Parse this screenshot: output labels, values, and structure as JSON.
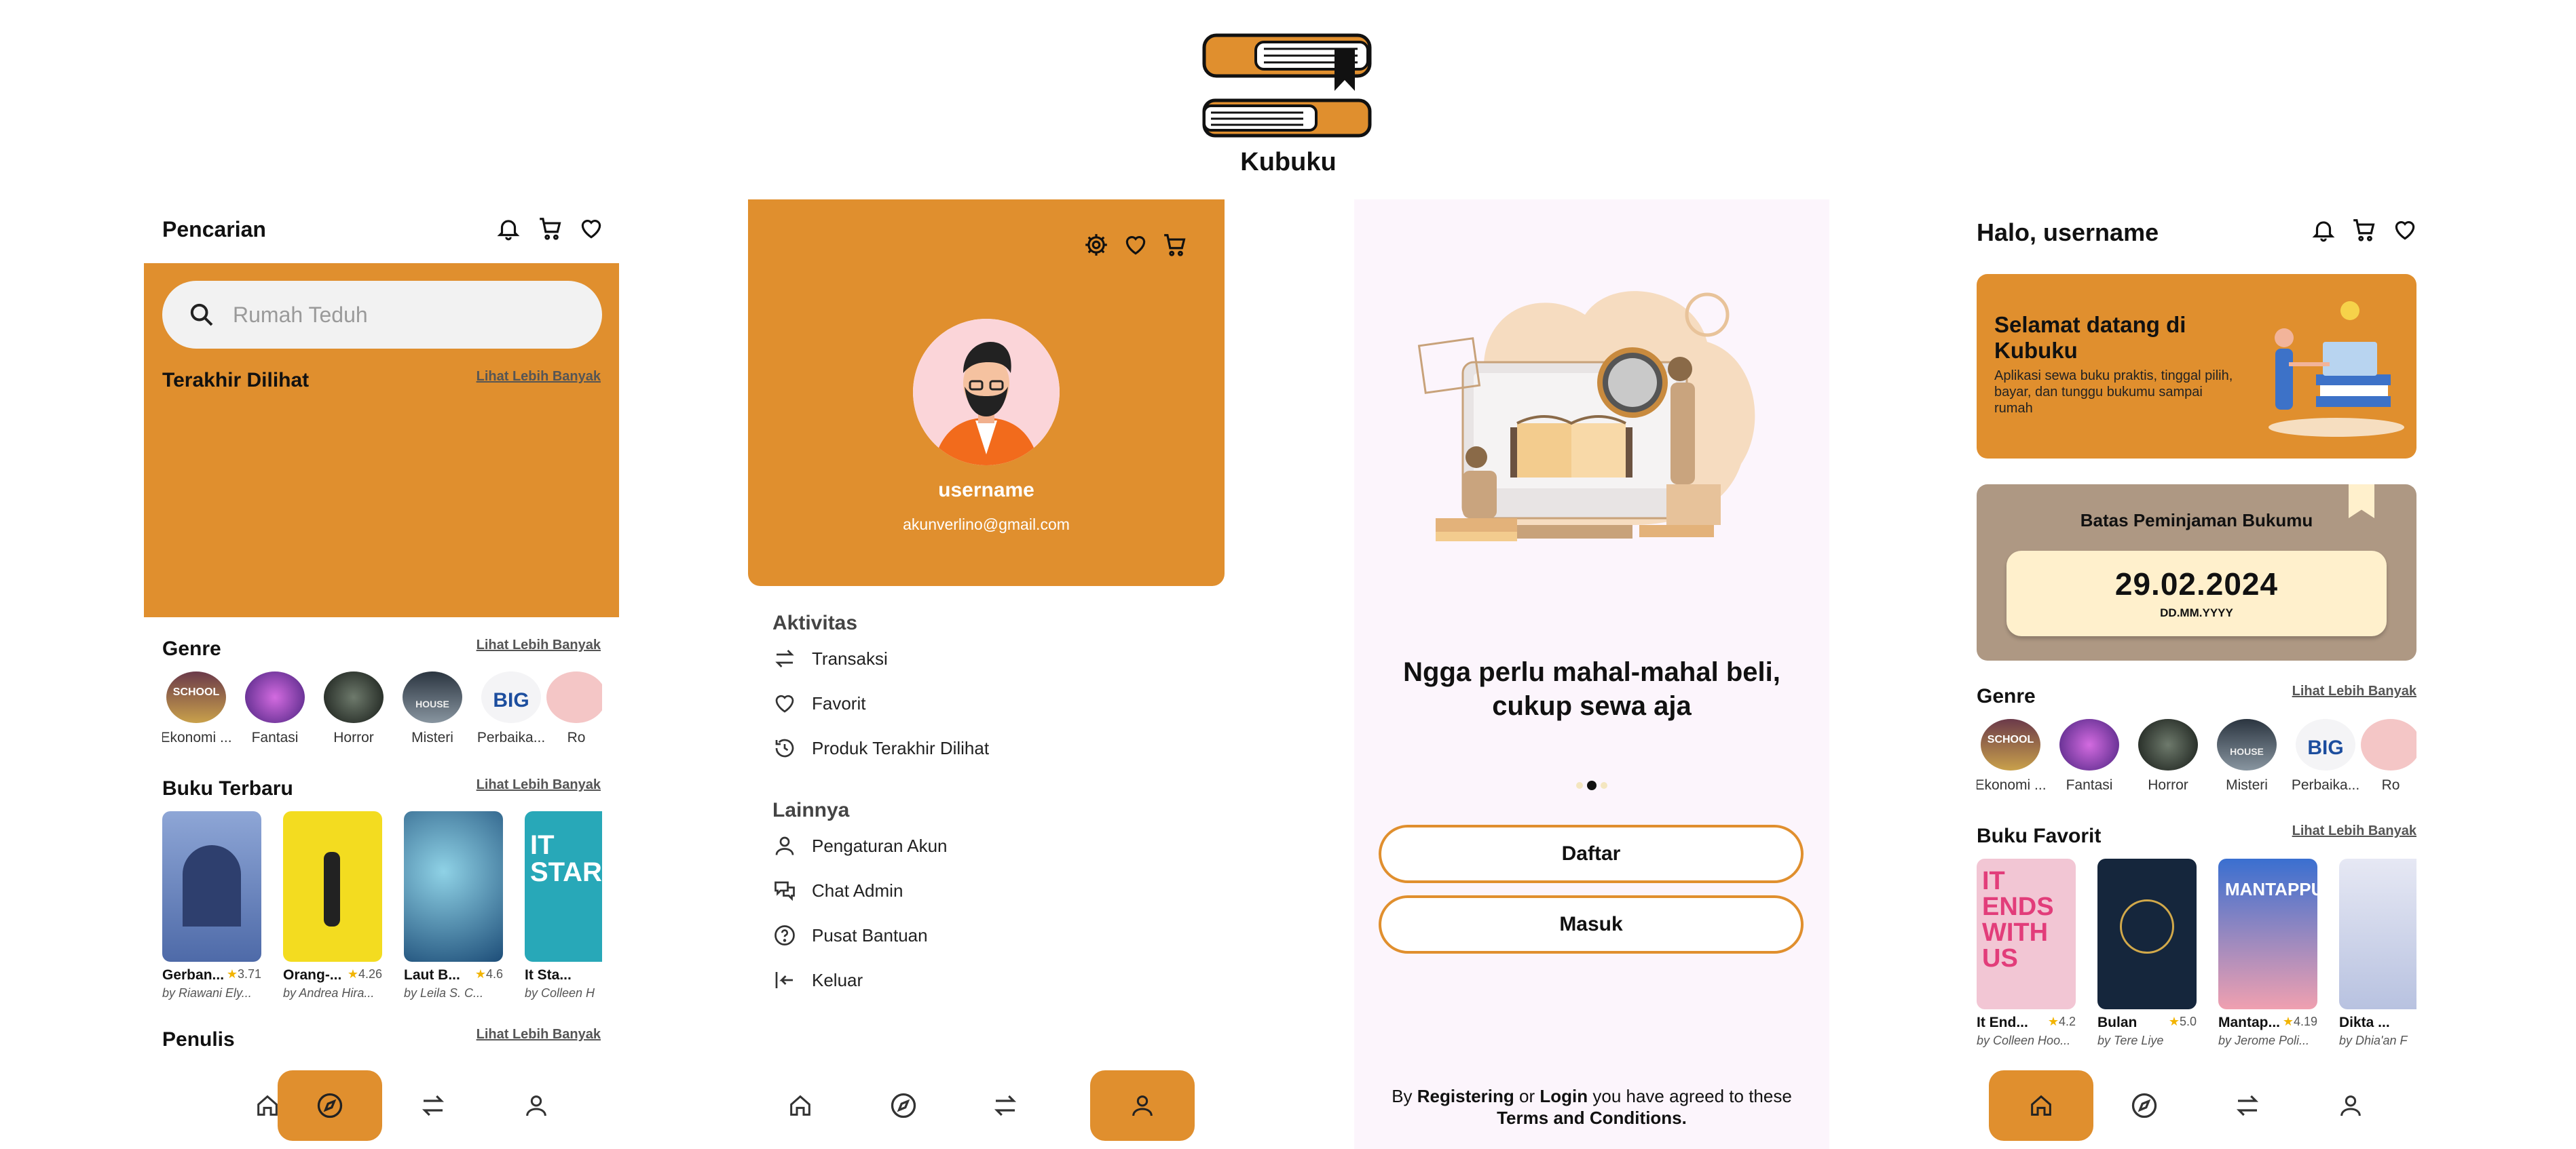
{
  "brand": {
    "name": "Kubuku",
    "color": "#E08F2E"
  },
  "colors": {
    "accent": "#E08F2E",
    "cream": "#FFF0CC",
    "taupe": "#AE9883",
    "onboarding_bg": "#FCF5FC"
  },
  "search_screen": {
    "header_title": "Pencarian",
    "header_icons": [
      "bell-icon",
      "cart-icon",
      "heart-icon"
    ],
    "search_placeholder": "Rumah Teduh",
    "recent_title": "Terakhir Dilihat",
    "recent_more": "Lihat Lebih Banyak",
    "genre_title": "Genre",
    "genre_more": "Lihat Lebih Banyak",
    "genres": [
      "Ekonomi ...",
      "Fantasi",
      "Horror",
      "Misteri",
      "Perbaika...",
      "Ro"
    ],
    "new_books_title": "Buku Terbaru",
    "new_books_more": "Lihat Lebih Banyak",
    "new_books": [
      {
        "title": "Gerban...",
        "rating": "3.71",
        "author": "by Riawani Ely..."
      },
      {
        "title": "Orang-...",
        "rating": "4.26",
        "author": "by Andrea Hira..."
      },
      {
        "title": "Laut B...",
        "rating": "4.6",
        "author": "by Leila S. C..."
      },
      {
        "title": "It Sta...",
        "rating": "",
        "author": "by Colleen H"
      }
    ],
    "writers_title": "Penulis",
    "writers_more": "Lihat Lebih Banyak",
    "active_nav": "explore"
  },
  "profile_screen": {
    "header_icons": [
      "settings-icon",
      "heart-icon",
      "cart-icon"
    ],
    "username": "username",
    "email": "akunverlino@gmail.com",
    "activity_title": "Aktivitas",
    "activity_items": [
      "Transaksi",
      "Favorit",
      "Produk Terakhir Dilihat"
    ],
    "other_title": "Lainnya",
    "other_items": [
      "Pengaturan Akun",
      "Chat Admin",
      "Pusat Bantuan",
      "Keluar"
    ],
    "active_nav": "profile"
  },
  "onboarding_screen": {
    "headline_line1": "Ngga perlu mahal-mahal beli,",
    "headline_line2": "cukup sewa aja",
    "register_button": "Daftar",
    "login_button": "Masuk",
    "terms_prefix": "By ",
    "terms_registering": "Registering",
    "terms_or": " or ",
    "terms_login": "Login",
    "terms_suffix": " you have agreed to these",
    "terms_link": "Terms and Conditions.",
    "page_indicator": {
      "total": 3,
      "current": 2
    }
  },
  "home_screen": {
    "greeting": "Halo, username",
    "header_icons": [
      "bell-icon",
      "cart-icon",
      "heart-icon"
    ],
    "welcome_title_line1": "Selamat datang di",
    "welcome_title_line2": "Kubuku",
    "welcome_desc": "Aplikasi sewa buku praktis, tinggal pilih, bayar, dan tunggu bukumu sampai rumah",
    "deadline_title": "Batas Peminjaman Bukumu",
    "deadline_date": "29.02.2024",
    "deadline_format": "DD.MM.YYYY",
    "genre_title": "Genre",
    "genre_more": "Lihat Lebih Banyak",
    "genres": [
      "Ekonomi ...",
      "Fantasi",
      "Horror",
      "Misteri",
      "Perbaika...",
      "Ro"
    ],
    "fav_title": "Buku Favorit",
    "fav_more": "Lihat Lebih Banyak",
    "fav_books": [
      {
        "title": "It End...",
        "rating": "4.2",
        "author": "by Colleen Hoo..."
      },
      {
        "title": "Bulan",
        "rating": "5.0",
        "author": "by Tere Liye"
      },
      {
        "title": "Mantap...",
        "rating": "4.19",
        "author": "by Jerome Poli..."
      },
      {
        "title": "Dikta ...",
        "rating": "",
        "author": "by Dhia'an F"
      }
    ],
    "active_nav": "home"
  },
  "nav_items": [
    "home-icon",
    "explore-icon",
    "transfer-icon",
    "profile-icon"
  ]
}
